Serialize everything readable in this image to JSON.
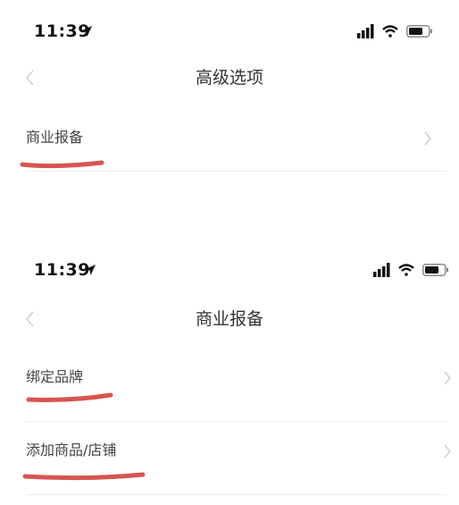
{
  "screens": [
    {
      "status_bar": {
        "time": "11:39"
      },
      "nav": {
        "title": "高级选项"
      },
      "items": [
        {
          "label": "商业报备"
        }
      ]
    },
    {
      "status_bar": {
        "time": "11:39"
      },
      "nav": {
        "title": "商业报备"
      },
      "items": [
        {
          "label": "绑定品牌"
        },
        {
          "label": "添加商品/店铺"
        }
      ]
    }
  ],
  "colors": {
    "annotation_underline": "#d9544f",
    "text": "#333333",
    "chevron": "#cccccc"
  },
  "icons": {
    "location": "location-arrow-icon",
    "signal": "signal-icon",
    "wifi": "wifi-icon",
    "battery": "battery-icon",
    "back": "chevron-left-icon",
    "disclosure": "chevron-right-icon"
  }
}
